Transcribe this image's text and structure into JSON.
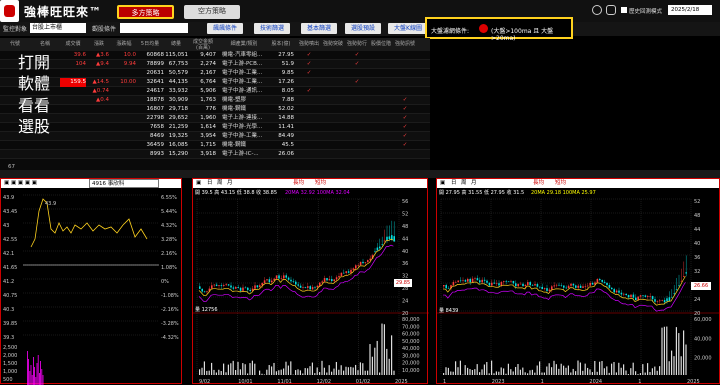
{
  "header": {
    "logo_text": "強棒旺旺來™",
    "tab_long": "多方策略",
    "tab_short": "空方策略",
    "history_checkbox": "歷史回測模式",
    "date_input": "2025/2/18"
  },
  "filters": {
    "monitor_label": "監控對象",
    "monitor_value": "台股上市櫃",
    "category_label": "觀股條件",
    "category_value": "",
    "buttons": [
      "飆飆條件",
      "技術篩選",
      "基本篩選",
      "選股預設",
      "大盤K線圖"
    ]
  },
  "market_filter": {
    "label": "大盤濾網條件:",
    "condition": "(大盤>100ma 且 大盤>20ma)"
  },
  "table": {
    "headers": [
      "代號",
      "名稱",
      "成交價",
      "漲跌",
      "漲跌幅",
      "5日均量",
      "總量",
      "成交金額(百萬)",
      "細產業/類別",
      "股本(億)",
      "強勢噴出",
      "強勢突破",
      "強勢勢行",
      "股價位階",
      "強勢訊號"
    ],
    "rows": [
      [
        "",
        "",
        "39.6",
        "▲3.6",
        "10.0",
        "60868",
        "115,051",
        "9,407",
        "機電-汽車零組...",
        "27.95"
      ],
      [
        "",
        "",
        "104",
        "▲9.4",
        "9.94",
        "78899",
        "67,753",
        "2,274",
        "電子上游-PCB...",
        "51.9"
      ],
      [
        "",
        "",
        "",
        "",
        "",
        "20631",
        "50,579",
        "2,167",
        "電子中游-工業...",
        "9.85"
      ],
      [
        "",
        "",
        "159.5",
        "▲14.5",
        "10.00",
        "32641",
        "44,135",
        "6,764",
        "電子中游-工業...",
        "17.26"
      ],
      [
        "",
        "",
        "",
        "▲0.74",
        "",
        "24617",
        "33,932",
        "5,906",
        "電子中游-通訊...",
        "8.05"
      ],
      [
        "",
        "",
        "",
        "▲0.4",
        "",
        "18878",
        "30,909",
        "1,763",
        "機電-塑膠",
        "7.88"
      ],
      [
        "",
        "",
        "",
        "",
        "",
        "16807",
        "29,718",
        "776",
        "機電-鋼鐵",
        "52.02"
      ],
      [
        "",
        "",
        "",
        "",
        "",
        "22798",
        "29,652",
        "1,960",
        "電子上游-連接...",
        "14.88"
      ],
      [
        "",
        "",
        "",
        "",
        "",
        "7658",
        "21,259",
        "1,614",
        "電子中游-光學...",
        "11.41"
      ],
      [
        "",
        "",
        "",
        "",
        "",
        "8469",
        "19,325",
        "3,954",
        "電子中游-工業...",
        "84.49"
      ],
      [
        "",
        "",
        "",
        "",
        "",
        "36459",
        "16,085",
        "1,715",
        "機電-鋼鐵",
        "45.5"
      ],
      [
        "",
        "",
        "",
        "",
        "",
        "8993",
        "15,290",
        "3,918",
        "電子上游-IC-...",
        "26.06"
      ]
    ],
    "overlay_text": [
      "打開",
      "軟體",
      "看看",
      "選股"
    ],
    "footer_count": "67"
  },
  "left_panel": {
    "title": "4916 事欣科",
    "price_label": "43.9",
    "price_axis": [
      "43.9",
      "43.45",
      "43",
      "42.55",
      "42.1",
      "41.65",
      "41.2",
      "40.75",
      "40.3",
      "39.85",
      "39.3"
    ],
    "pct_axis": [
      "6.55%",
      "5.44%",
      "4.32%",
      "3.28%",
      "2.16%",
      "1.08%",
      "0%",
      "-1.08%",
      "-2.16%",
      "-3.28%",
      "-4.32%"
    ],
    "vol_axis": [
      "2,500",
      "2,000",
      "1,500",
      "1,000",
      "500"
    ]
  },
  "mid_panel": {
    "tabs": [
      "日",
      "周",
      "月"
    ],
    "toggles": [
      "長均",
      "短均"
    ],
    "info": "開 39.5  高 43.15  低 38.8  收 38.85",
    "ma_info": "20MA 32.92   100MA 32.04",
    "vol_info": "量 12756",
    "last_price": "29.85",
    "y_axis": [
      "56",
      "52",
      "48",
      "44",
      "40",
      "36",
      "32",
      "28",
      "24",
      "20"
    ],
    "vol_axis": [
      "80,000",
      "70,000",
      "60,000",
      "50,000",
      "40,000",
      "30,000",
      "20,000",
      "10,000"
    ],
    "x_axis": [
      "9/02",
      "10/01",
      "11/01",
      "12/02",
      "01/02",
      "2025"
    ]
  },
  "right_panel": {
    "tabs": [
      "日",
      "周",
      "月"
    ],
    "toggles": [
      "長均",
      "短均"
    ],
    "info": "開 27.95  高 31.55  低 27.95  收 31.5",
    "ma_info": "20MA 29.18   100MA 25.97",
    "vol_info": "量 8439",
    "last_price": "26.66",
    "y_axis": [
      "52",
      "48",
      "44",
      "40",
      "36",
      "32",
      "28",
      "24",
      "20"
    ],
    "vol_axis": [
      "60,000",
      "40,000",
      "20,000"
    ],
    "x_axis": [
      "1",
      "2023",
      "1",
      "2024",
      "1",
      "2025"
    ]
  },
  "colors": {
    "up": "#ff3b3b",
    "down": "#00c800",
    "accent": "#ffd21e",
    "panel_border": "#cc0000"
  }
}
